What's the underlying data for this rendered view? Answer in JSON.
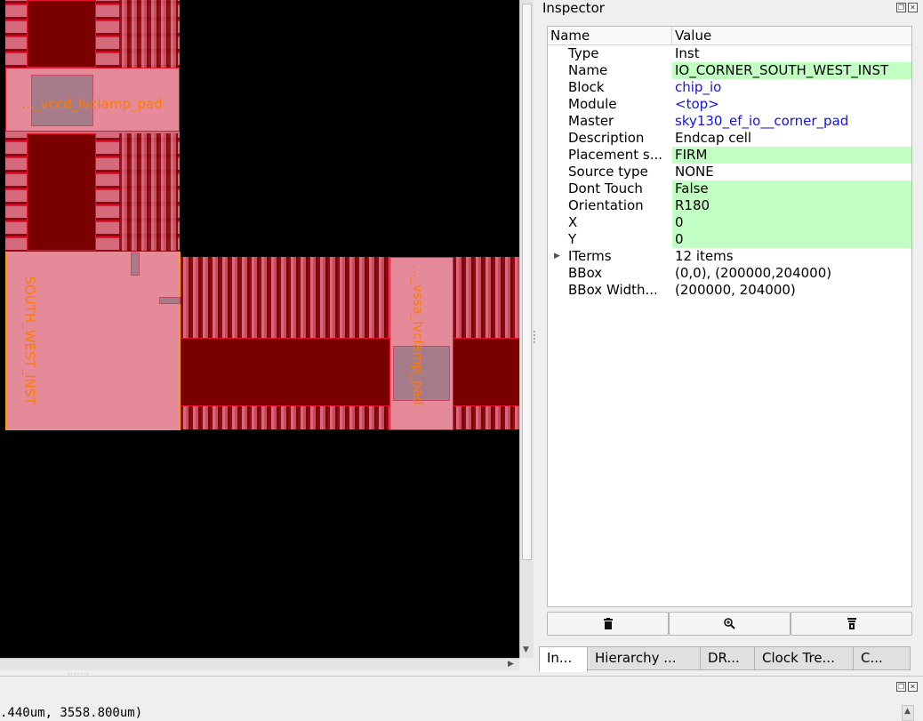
{
  "canvas": {
    "labels": {
      "vccd_pad": "..._vccd_lvclamp_pad",
      "vssa_pad": "..._vssa_lvclamp_pad",
      "corner_inst": "SOUTH_WEST_INST"
    },
    "colors": {
      "background": "#000000",
      "instance_fill": "#e58a98",
      "instance_border": "#e8112b",
      "metal": "#7a0000",
      "label": "#ff7b00"
    }
  },
  "inspector": {
    "title": "Inspector",
    "columns": {
      "name": "Name",
      "value": "Value"
    },
    "rows": [
      {
        "name": "Type",
        "value": "Inst"
      },
      {
        "name": "Name",
        "value": "IO_CORNER_SOUTH_WEST_INST"
      },
      {
        "name": "Block",
        "value": "chip_io"
      },
      {
        "name": "Module",
        "value": "<top>"
      },
      {
        "name": "Master",
        "value": "sky130_ef_io__corner_pad"
      },
      {
        "name": "Description",
        "value": "Endcap cell"
      },
      {
        "name": "Placement s...",
        "value": "FIRM"
      },
      {
        "name": "Source type",
        "value": "NONE"
      },
      {
        "name": "Dont Touch",
        "value": "False"
      },
      {
        "name": "Orientation",
        "value": "R180"
      },
      {
        "name": "X",
        "value": "0"
      },
      {
        "name": "Y",
        "value": "0"
      },
      {
        "name": "ITerms",
        "value": "12 items"
      },
      {
        "name": "BBox",
        "value": "(0,0), (200000,204000)"
      },
      {
        "name": "BBox Width...",
        "value": "(200000, 204000)"
      }
    ],
    "actions": {
      "delete": "delete-icon",
      "zoom": "zoom-in-icon",
      "select": "select-icon"
    },
    "highlight_color": "#c2ffc2",
    "link_color": "#1515d8"
  },
  "tabs": [
    "In...",
    "Hierarchy ...",
    "DR...",
    "Clock Tre...",
    "C..."
  ],
  "console": {
    "text": ".440um, 3558.800um)"
  }
}
